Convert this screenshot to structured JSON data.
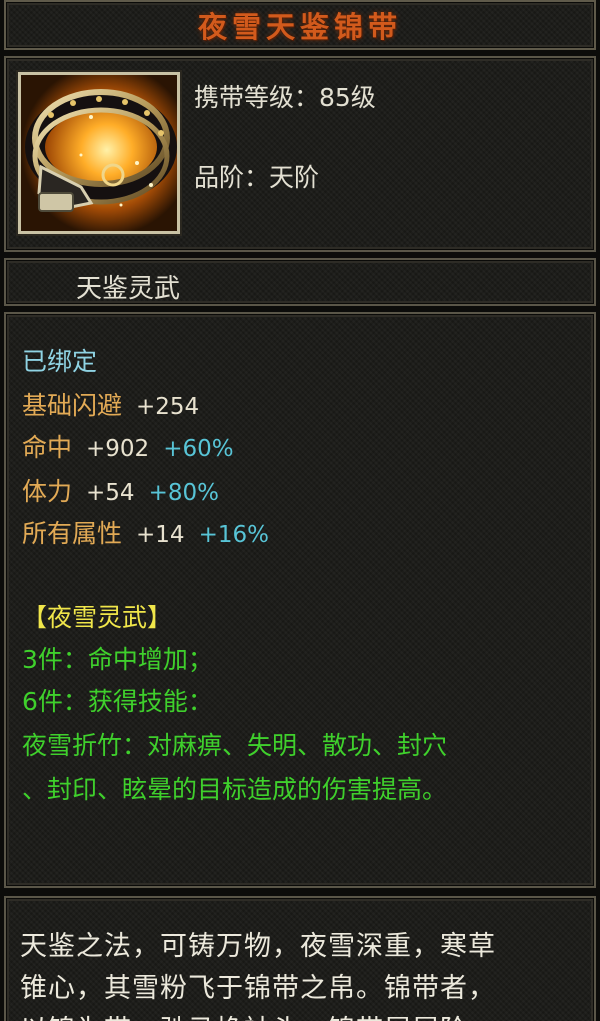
{
  "item": {
    "name": "夜雪天鉴锦带",
    "icon": "belt-icon",
    "carry_level": "携带等级：85级",
    "grade": "品阶：天阶",
    "subtitle": "天鉴灵武"
  },
  "stats": {
    "bound": "已绑定",
    "lines": [
      {
        "label": "基础闪避",
        "value": "+254",
        "pct": ""
      },
      {
        "label": "命中",
        "value": "+902",
        "pct": "+60%"
      },
      {
        "label": "体力",
        "value": "+54",
        "pct": "+80%"
      },
      {
        "label": "所有属性",
        "value": "+14",
        "pct": "+16%"
      }
    ]
  },
  "set_bonus": {
    "title": "【夜雪灵武】",
    "piece3": "3件：命中增加；",
    "piece6": "6件：获得技能：",
    "skill_line1": "夜雪折竹：对麻痹、失明、散功、封穴",
    "skill_line2": "、封印、眩晕的目标造成的伤害提高。"
  },
  "description": {
    "line1": "天鉴之法，可铸万物，夜雪深重，寒草",
    "line2": "锥心，其雪粉飞于锦带之帛。锦带者，",
    "line3": "以锦为带，驰马挽袖头，锦带屡屡阶"
  },
  "colors": {
    "title": "#d25a1c",
    "stat_label": "#e2aa55",
    "stat_percent": "#58c4d6",
    "bound": "#8fd3e3",
    "set_title": "#f0e64a",
    "set_text": "#3fd02c"
  }
}
